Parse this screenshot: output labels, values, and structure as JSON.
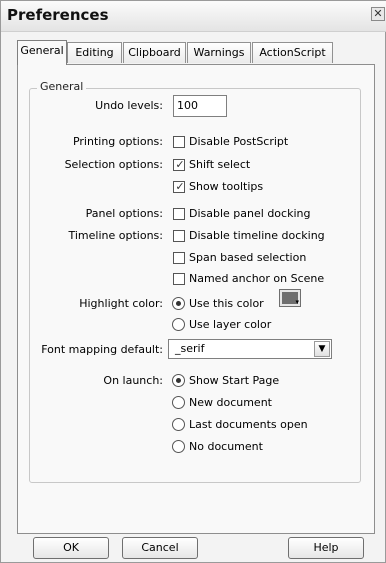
{
  "window": {
    "title": "Preferences",
    "close_glyph": "✕"
  },
  "tabs": [
    {
      "label": "General",
      "active": true
    },
    {
      "label": "Editing",
      "active": false
    },
    {
      "label": "Clipboard",
      "active": false
    },
    {
      "label": "Warnings",
      "active": false
    },
    {
      "label": "ActionScript",
      "active": false
    }
  ],
  "general": {
    "group_title": "General",
    "undo_levels": {
      "label": "Undo levels:",
      "value": "100"
    },
    "printing": {
      "label": "Printing options:",
      "disable_postscript": {
        "label": "Disable PostScript",
        "checked": false
      }
    },
    "selection": {
      "label": "Selection options:",
      "shift_select": {
        "label": "Shift select",
        "checked": true
      },
      "show_tooltips": {
        "label": "Show tooltips",
        "checked": true
      }
    },
    "panel": {
      "label": "Panel options:",
      "disable_panel_docking": {
        "label": "Disable panel docking",
        "checked": false
      }
    },
    "timeline": {
      "label": "Timeline options:",
      "disable_timeline_docking": {
        "label": "Disable timeline docking",
        "checked": false
      },
      "span_based_selection": {
        "label": "Span based selection",
        "checked": false
      },
      "named_anchor": {
        "label": "Named anchor on Scene",
        "checked": false
      }
    },
    "highlight": {
      "label": "Highlight color:",
      "use_this_color": {
        "label": "Use this color",
        "selected": true
      },
      "use_layer_color": {
        "label": "Use layer color",
        "selected": false
      },
      "swatch_color": "#6e6e6e"
    },
    "font_mapping": {
      "label": "Font mapping default:",
      "value": "_serif"
    },
    "on_launch": {
      "label": "On launch:",
      "options": [
        {
          "label": "Show Start Page",
          "selected": true
        },
        {
          "label": "New document",
          "selected": false
        },
        {
          "label": "Last documents open",
          "selected": false
        },
        {
          "label": "No document",
          "selected": false
        }
      ]
    }
  },
  "buttons": {
    "ok": "OK",
    "cancel": "Cancel",
    "help": "Help"
  },
  "icons": {
    "checkmark": "✓",
    "dropdown": "▼",
    "swatch_arrow": "▾"
  }
}
